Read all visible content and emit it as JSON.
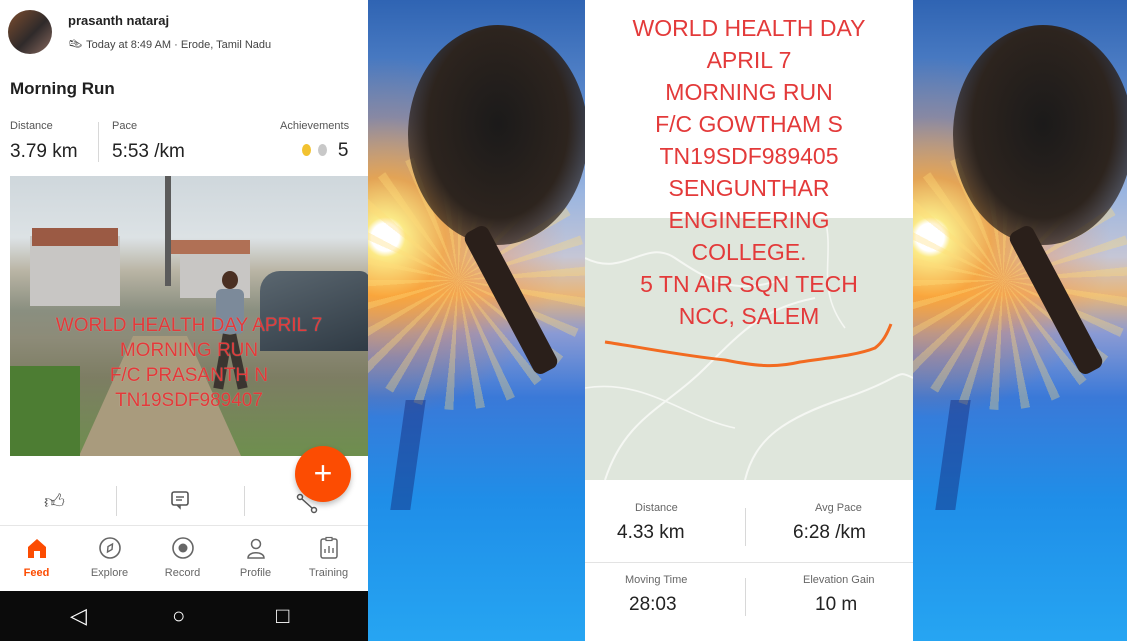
{
  "activity": {
    "user_name": "prasanth nataraj",
    "meta": "Today at 8:49 AM · Erode, Tamil Nadu",
    "title": "Morning Run",
    "stats": {
      "distance_label": "Distance",
      "distance_value": "3.79 km",
      "pace_label": "Pace",
      "pace_value": "5:53 /km",
      "achievements_label": "Achievements",
      "achievements_value": "5"
    },
    "photo_overlay": [
      "WORLD HEALTH DAY APRIL 7",
      "MORNING RUN",
      "F/C PRASANTH N",
      "TN19SDF989407"
    ]
  },
  "fab": {
    "label": "+"
  },
  "tabbar": {
    "items": [
      {
        "label": "Feed",
        "icon": "home-icon",
        "active": true
      },
      {
        "label": "Explore",
        "icon": "compass-icon",
        "active": false
      },
      {
        "label": "Record",
        "icon": "record-icon",
        "active": false
      },
      {
        "label": "Profile",
        "icon": "person-icon",
        "active": false
      },
      {
        "label": "Training",
        "icon": "clipboard-chart-icon",
        "active": false
      }
    ]
  },
  "navbar": {
    "back": "◁",
    "home": "○",
    "recents": "□"
  },
  "right_activity": {
    "overlay_lines": [
      "WORLD HEALTH DAY",
      "APRIL 7",
      "MORNING RUN",
      "F/C GOWTHAM S",
      "TN19SDF989405",
      "SENGUNTHAR",
      "ENGINEERING",
      "COLLEGE.",
      "5 TN AIR SQN TECH",
      "NCC, SALEM"
    ],
    "stats": {
      "distance_label": "Distance",
      "distance_value": "4.33 km",
      "avg_pace_label": "Avg Pace",
      "avg_pace_value": "6:28 /km",
      "moving_time_label": "Moving Time",
      "moving_time_value": "28:03",
      "elevation_label": "Elevation Gain",
      "elevation_value": "10 m"
    }
  },
  "colors": {
    "accent": "#fc4c02",
    "overlay_text": "#e33a3a"
  }
}
